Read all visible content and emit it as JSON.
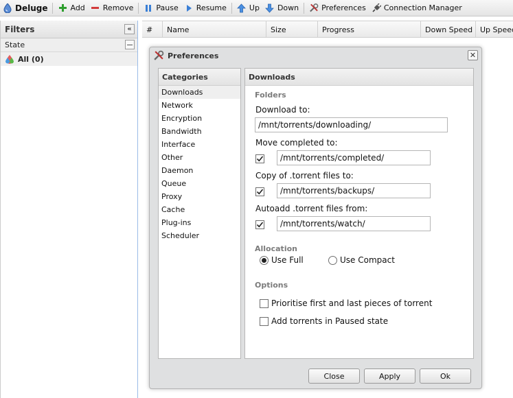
{
  "toolbar": {
    "brand": "Deluge",
    "add": "Add",
    "remove": "Remove",
    "pause": "Pause",
    "resume": "Resume",
    "up": "Up",
    "down": "Down",
    "preferences": "Preferences",
    "connection_manager": "Connection Manager"
  },
  "filters": {
    "title": "Filters",
    "state_label": "State",
    "all_item": "All (0)"
  },
  "grid": {
    "columns": [
      "#",
      "Name",
      "Size",
      "Progress",
      "Down Speed",
      "Up Speed"
    ]
  },
  "preferences": {
    "title": "Preferences",
    "categories_title": "Categories",
    "categories": [
      "Downloads",
      "Network",
      "Encryption",
      "Bandwidth",
      "Interface",
      "Other",
      "Daemon",
      "Queue",
      "Proxy",
      "Cache",
      "Plug-ins",
      "Scheduler"
    ],
    "selected_category": "Downloads",
    "panel_title": "Downloads",
    "folders": {
      "title": "Folders",
      "download_to_label": "Download to:",
      "download_to_value": "/mnt/torrents/downloading/",
      "move_completed_label": "Move completed to:",
      "move_completed_value": "/mnt/torrents/completed/",
      "move_completed_checked": true,
      "copy_torrent_label": "Copy of .torrent files to:",
      "copy_torrent_value": "/mnt/torrents/backups/",
      "copy_torrent_checked": true,
      "autoadd_label": "Autoadd .torrent files from:",
      "autoadd_value": "/mnt/torrents/watch/",
      "autoadd_checked": true
    },
    "allocation": {
      "title": "Allocation",
      "use_full": "Use Full",
      "use_compact": "Use Compact",
      "selected": "Use Full"
    },
    "options": {
      "title": "Options",
      "prioritise": "Prioritise first and last pieces of torrent",
      "prioritise_checked": false,
      "add_paused": "Add torrents in Paused state",
      "add_paused_checked": false
    },
    "buttons": {
      "close": "Close",
      "apply": "Apply",
      "ok": "Ok"
    }
  },
  "colors": {
    "add_icon": "#2e9e2e",
    "remove_icon": "#d23a3a",
    "arrow_icon": "#3a7fd6",
    "panel_border": "#b6b6b6"
  }
}
